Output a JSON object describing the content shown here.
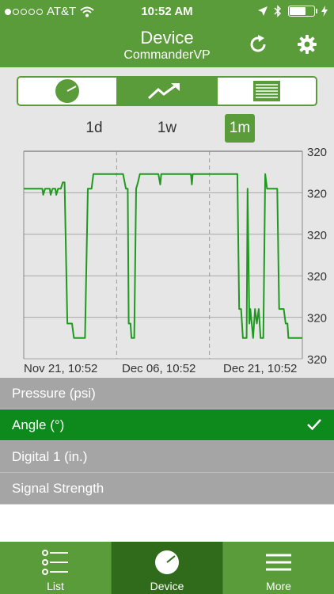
{
  "status_bar": {
    "carrier": "AT&T",
    "time": "10:52 AM"
  },
  "nav": {
    "title": "Device",
    "subtitle": "CommanderVP"
  },
  "time_ranges": [
    {
      "label": "1d",
      "active": false
    },
    {
      "label": "1w",
      "active": false
    },
    {
      "label": "1m",
      "active": true
    }
  ],
  "chart_data": {
    "type": "line",
    "title": "",
    "x_tick_labels": [
      "Nov 21, 10:52",
      "Dec 06, 10:52",
      "Dec 21, 10:52"
    ],
    "y_tick_labels": [
      "320",
      "320",
      "320",
      "320",
      "320",
      "320"
    ],
    "x_range": [
      0,
      30
    ],
    "y_range": [
      0,
      100
    ],
    "grid": true,
    "series": [
      {
        "color": "#1f9a1f",
        "points": [
          [
            0.0,
            82
          ],
          [
            2.0,
            82
          ],
          [
            2.1,
            79
          ],
          [
            2.3,
            82
          ],
          [
            2.8,
            82
          ],
          [
            2.9,
            79
          ],
          [
            3.1,
            82
          ],
          [
            3.4,
            82
          ],
          [
            3.5,
            79
          ],
          [
            3.7,
            82
          ],
          [
            4.0,
            82
          ],
          [
            4.2,
            85
          ],
          [
            4.4,
            85
          ],
          [
            4.7,
            17
          ],
          [
            5.2,
            17
          ],
          [
            5.4,
            10
          ],
          [
            6.6,
            10
          ],
          [
            6.9,
            82
          ],
          [
            7.3,
            82
          ],
          [
            7.5,
            89
          ],
          [
            10.7,
            89
          ],
          [
            11.0,
            82
          ],
          [
            11.2,
            82
          ],
          [
            11.3,
            17
          ],
          [
            11.5,
            17
          ],
          [
            11.6,
            10
          ],
          [
            11.9,
            10
          ],
          [
            12.1,
            82
          ],
          [
            12.3,
            85
          ],
          [
            12.5,
            89
          ],
          [
            14.5,
            89
          ],
          [
            14.7,
            84
          ],
          [
            14.8,
            89
          ],
          [
            18.0,
            89
          ],
          [
            18.1,
            84
          ],
          [
            18.2,
            89
          ],
          [
            23.0,
            89
          ],
          [
            23.2,
            24
          ],
          [
            23.4,
            24
          ],
          [
            23.6,
            10
          ],
          [
            24.0,
            10
          ],
          [
            24.1,
            82
          ],
          [
            24.3,
            17
          ],
          [
            24.4,
            24
          ],
          [
            24.7,
            10
          ],
          [
            24.9,
            24
          ],
          [
            25.1,
            17
          ],
          [
            25.3,
            24
          ],
          [
            25.5,
            10
          ],
          [
            25.8,
            10
          ],
          [
            26.0,
            89
          ],
          [
            26.2,
            82
          ],
          [
            27.3,
            82
          ],
          [
            27.5,
            24
          ],
          [
            28.0,
            24
          ],
          [
            28.2,
            17
          ],
          [
            28.4,
            17
          ],
          [
            28.5,
            10
          ],
          [
            30.0,
            10
          ]
        ]
      }
    ]
  },
  "measurements": [
    {
      "label": "Pressure (psi)",
      "selected": false
    },
    {
      "label": "Angle (°)",
      "selected": true
    },
    {
      "label": "Digital 1 (in.)",
      "selected": false
    },
    {
      "label": "Signal Strength",
      "selected": false
    }
  ],
  "tabs": [
    {
      "label": "List",
      "icon": "list-icon",
      "active": false
    },
    {
      "label": "Device",
      "icon": "gauge-icon",
      "active": true
    },
    {
      "label": "More",
      "icon": "menu-icon",
      "active": false
    }
  ]
}
